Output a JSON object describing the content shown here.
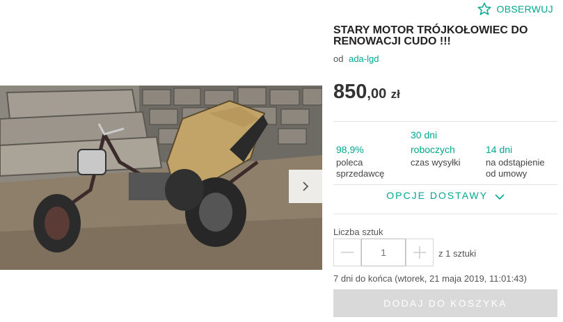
{
  "header": {
    "watch_label": "OBSERWUJ",
    "watch_icon": "star-outline-icon"
  },
  "offer": {
    "title": "STARY MOTOR TRÓJKOŁOWIEC DO RENOWACJI CUDO !!!",
    "seller_prefix": "od",
    "seller_name": "ada-lgd",
    "price_whole": "850",
    "price_cents": ",00",
    "currency": "zł"
  },
  "stats": [
    {
      "value": "98,9%",
      "label_line1": "poleca",
      "label_line2": "sprzedawcę"
    },
    {
      "value_line1": "30 dni",
      "value_line2": "roboczych",
      "label_line1": "czas wysyłki"
    },
    {
      "value": "14 dni",
      "label_line1": "na odstąpienie",
      "label_line2": "od umowy"
    }
  ],
  "delivery": {
    "label": "OPCJE DOSTAWY",
    "icon": "chevron-down-icon"
  },
  "quantity": {
    "label": "Liczba sztuk",
    "placeholder": "1",
    "of_text": "z 1 sztuki",
    "minus_icon": "minus-icon",
    "plus_icon": "plus-icon"
  },
  "ending": "7 dni do końca (wtorek, 21 maja 2019, 11:01:43)",
  "add_to_cart": "DODAJ DO KOSZYKA",
  "colors": {
    "accent": "#00a790",
    "button_disabled": "#d9d9d9",
    "text": "#222222"
  }
}
